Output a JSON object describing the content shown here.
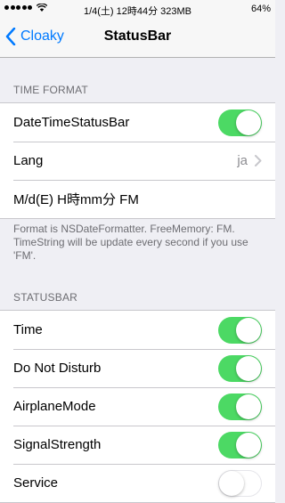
{
  "status_bar": {
    "signal_dots": 5,
    "center_text": "1/4(土) 12時44分 323MB",
    "battery": "64%",
    "wifi_icon": "wifi-icon"
  },
  "nav": {
    "back_label": "Cloaky",
    "title": "StatusBar"
  },
  "sections": {
    "time_format": {
      "header": "TIME FORMAT",
      "rows": [
        {
          "label": "DateTimeStatusBar",
          "toggle": true
        },
        {
          "label": "Lang",
          "value": "ja"
        },
        {
          "label": "M/d(E) H時mm分 FM"
        }
      ],
      "footer": "Format is NSDateFormatter. FreeMemory: FM. TimeString will be update every second if you use 'FM'."
    },
    "statusbar": {
      "header": "STATUSBAR",
      "rows": [
        {
          "label": "Time",
          "toggle": true
        },
        {
          "label": "Do Not Disturb",
          "toggle": true
        },
        {
          "label": "AirplaneMode",
          "toggle": true
        },
        {
          "label": "SignalStrength",
          "toggle": true
        },
        {
          "label": "Service",
          "toggle": false
        }
      ]
    }
  },
  "colors": {
    "accent": "#007aff",
    "toggle_on": "#4cd964",
    "background": "#efeff4"
  }
}
